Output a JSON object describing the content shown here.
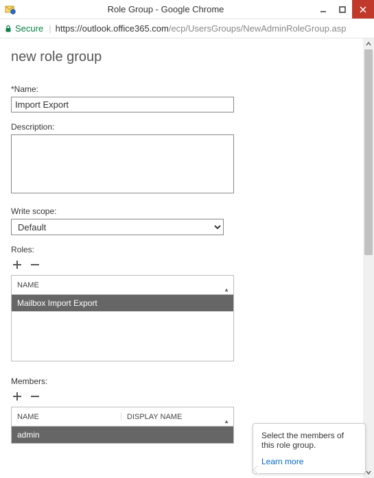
{
  "window": {
    "title": "Role Group - Google Chrome"
  },
  "address": {
    "secure_label": "Secure",
    "host": "https://outlook.office365.com",
    "path": "/ecp/UsersGroups/NewAdminRoleGroup.asp"
  },
  "page": {
    "heading": "new role group",
    "name_label": "*Name:",
    "name_value": "Import Export",
    "description_label": "Description:",
    "description_value": "",
    "scope_label": "Write scope:",
    "scope_value": "Default",
    "roles_label": "Roles:",
    "roles_header_name": "NAME",
    "roles_rows": [
      "Mailbox Import Export"
    ],
    "members_label": "Members:",
    "members_header_name": "NAME",
    "members_header_display": "DISPLAY NAME",
    "members_rows": [
      {
        "name": "admin",
        "display": ""
      }
    ]
  },
  "tooltip": {
    "text": "Select the members of this role group.",
    "link": "Learn more"
  }
}
